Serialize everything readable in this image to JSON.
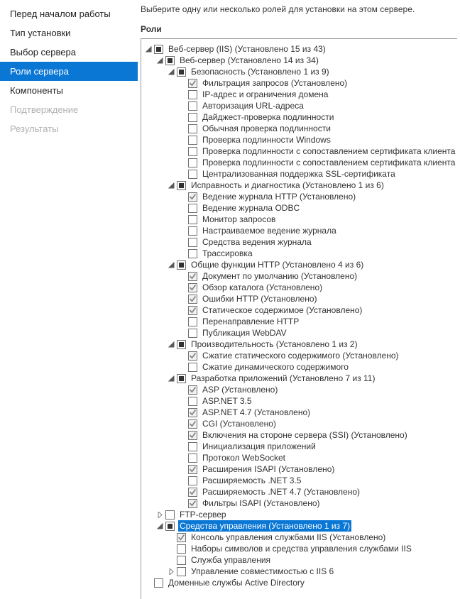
{
  "instruction": "Выберите одну или несколько ролей для установки на этом сервере.",
  "section_label": "Роли",
  "sidebar": {
    "items": [
      {
        "label": "Перед началом работы",
        "state": "normal"
      },
      {
        "label": "Тип установки",
        "state": "normal"
      },
      {
        "label": "Выбор сервера",
        "state": "normal"
      },
      {
        "label": "Роли сервера",
        "state": "selected"
      },
      {
        "label": "Компоненты",
        "state": "normal"
      },
      {
        "label": "Подтверждение",
        "state": "disabled"
      },
      {
        "label": "Результаты",
        "state": "disabled"
      }
    ]
  },
  "tree": [
    {
      "label": "Веб-сервер (IIS) (Установлено 15 из 43)",
      "cb": "partial",
      "expander": "open",
      "children": [
        {
          "label": "Веб-сервер (Установлено 14 из 34)",
          "cb": "partial",
          "expander": "open",
          "children": [
            {
              "label": "Безопасность (Установлено 1 из 9)",
              "cb": "partial",
              "expander": "open",
              "children": [
                {
                  "label": "Фильтрация запросов (Установлено)",
                  "cb": "checked",
                  "expander": "none"
                },
                {
                  "label": "IP-адрес и ограничения домена",
                  "cb": "unchecked",
                  "expander": "none"
                },
                {
                  "label": "Авторизация URL-адреса",
                  "cb": "unchecked",
                  "expander": "none"
                },
                {
                  "label": "Дайджест-проверка подлинности",
                  "cb": "unchecked",
                  "expander": "none"
                },
                {
                  "label": "Обычная проверка подлинности",
                  "cb": "unchecked",
                  "expander": "none"
                },
                {
                  "label": "Проверка подлинности Windows",
                  "cb": "unchecked",
                  "expander": "none"
                },
                {
                  "label": "Проверка подлинности с сопоставлением сертификата клиента",
                  "cb": "unchecked",
                  "expander": "none"
                },
                {
                  "label": "Проверка подлинности с сопоставлением сертификата клиента",
                  "cb": "unchecked",
                  "expander": "none"
                },
                {
                  "label": "Централизованная поддержка SSL-сертификата",
                  "cb": "unchecked",
                  "expander": "none"
                }
              ]
            },
            {
              "label": "Исправность и диагностика (Установлено 1 из 6)",
              "cb": "partial",
              "expander": "open",
              "children": [
                {
                  "label": "Ведение журнала HTTP (Установлено)",
                  "cb": "checked",
                  "expander": "none"
                },
                {
                  "label": "Ведение журнала ODBC",
                  "cb": "unchecked",
                  "expander": "none"
                },
                {
                  "label": "Монитор запросов",
                  "cb": "unchecked",
                  "expander": "none"
                },
                {
                  "label": "Настраиваемое ведение журнала",
                  "cb": "unchecked",
                  "expander": "none"
                },
                {
                  "label": "Средства ведения журнала",
                  "cb": "unchecked",
                  "expander": "none"
                },
                {
                  "label": "Трассировка",
                  "cb": "unchecked",
                  "expander": "none"
                }
              ]
            },
            {
              "label": "Общие функции HTTP (Установлено 4 из 6)",
              "cb": "partial",
              "expander": "open",
              "children": [
                {
                  "label": "Документ по умолчанию (Установлено)",
                  "cb": "checked",
                  "expander": "none"
                },
                {
                  "label": "Обзор каталога (Установлено)",
                  "cb": "checked",
                  "expander": "none"
                },
                {
                  "label": "Ошибки HTTP (Установлено)",
                  "cb": "checked",
                  "expander": "none"
                },
                {
                  "label": "Статическое содержимое (Установлено)",
                  "cb": "checked",
                  "expander": "none"
                },
                {
                  "label": "Перенаправление HTTP",
                  "cb": "unchecked",
                  "expander": "none"
                },
                {
                  "label": "Публикация WebDAV",
                  "cb": "unchecked",
                  "expander": "none"
                }
              ]
            },
            {
              "label": "Производительность (Установлено 1 из 2)",
              "cb": "partial",
              "expander": "open",
              "children": [
                {
                  "label": "Сжатие статического содержимого (Установлено)",
                  "cb": "checked",
                  "expander": "none"
                },
                {
                  "label": "Сжатие динамического содержимого",
                  "cb": "unchecked",
                  "expander": "none"
                }
              ]
            },
            {
              "label": "Разработка приложений (Установлено 7 из 11)",
              "cb": "partial",
              "expander": "open",
              "children": [
                {
                  "label": "ASP (Установлено)",
                  "cb": "checked",
                  "expander": "none"
                },
                {
                  "label": "ASP.NET 3.5",
                  "cb": "unchecked",
                  "expander": "none"
                },
                {
                  "label": "ASP.NET 4.7 (Установлено)",
                  "cb": "checked",
                  "expander": "none"
                },
                {
                  "label": "CGI (Установлено)",
                  "cb": "checked",
                  "expander": "none"
                },
                {
                  "label": "Включения на стороне сервера (SSI) (Установлено)",
                  "cb": "checked",
                  "expander": "none"
                },
                {
                  "label": "Инициализация приложений",
                  "cb": "unchecked",
                  "expander": "none"
                },
                {
                  "label": "Протокол WebSocket",
                  "cb": "unchecked",
                  "expander": "none"
                },
                {
                  "label": "Расширения ISAPI (Установлено)",
                  "cb": "checked",
                  "expander": "none"
                },
                {
                  "label": "Расширяемость .NET 3.5",
                  "cb": "unchecked",
                  "expander": "none"
                },
                {
                  "label": "Расширяемость .NET 4.7 (Установлено)",
                  "cb": "checked",
                  "expander": "none"
                },
                {
                  "label": "Фильтры ISAPI (Установлено)",
                  "cb": "checked",
                  "expander": "none"
                }
              ]
            }
          ]
        },
        {
          "label": "FTP-сервер",
          "cb": "unchecked",
          "expander": "closed"
        },
        {
          "label": "Средства управления (Установлено 1 из 7)",
          "cb": "partial",
          "expander": "open",
          "selected": true,
          "children": [
            {
              "label": "Консоль управления службами IIS (Установлено)",
              "cb": "checked",
              "expander": "none"
            },
            {
              "label": "Наборы символов и средства управления службами IIS",
              "cb": "unchecked",
              "expander": "none"
            },
            {
              "label": "Служба управления",
              "cb": "unchecked",
              "expander": "none"
            },
            {
              "label": "Управление совместимостью с IIS 6",
              "cb": "unchecked",
              "expander": "closed"
            }
          ]
        }
      ]
    },
    {
      "label": "Доменные службы Active Directory",
      "cb": "unchecked",
      "expander": "none"
    }
  ]
}
